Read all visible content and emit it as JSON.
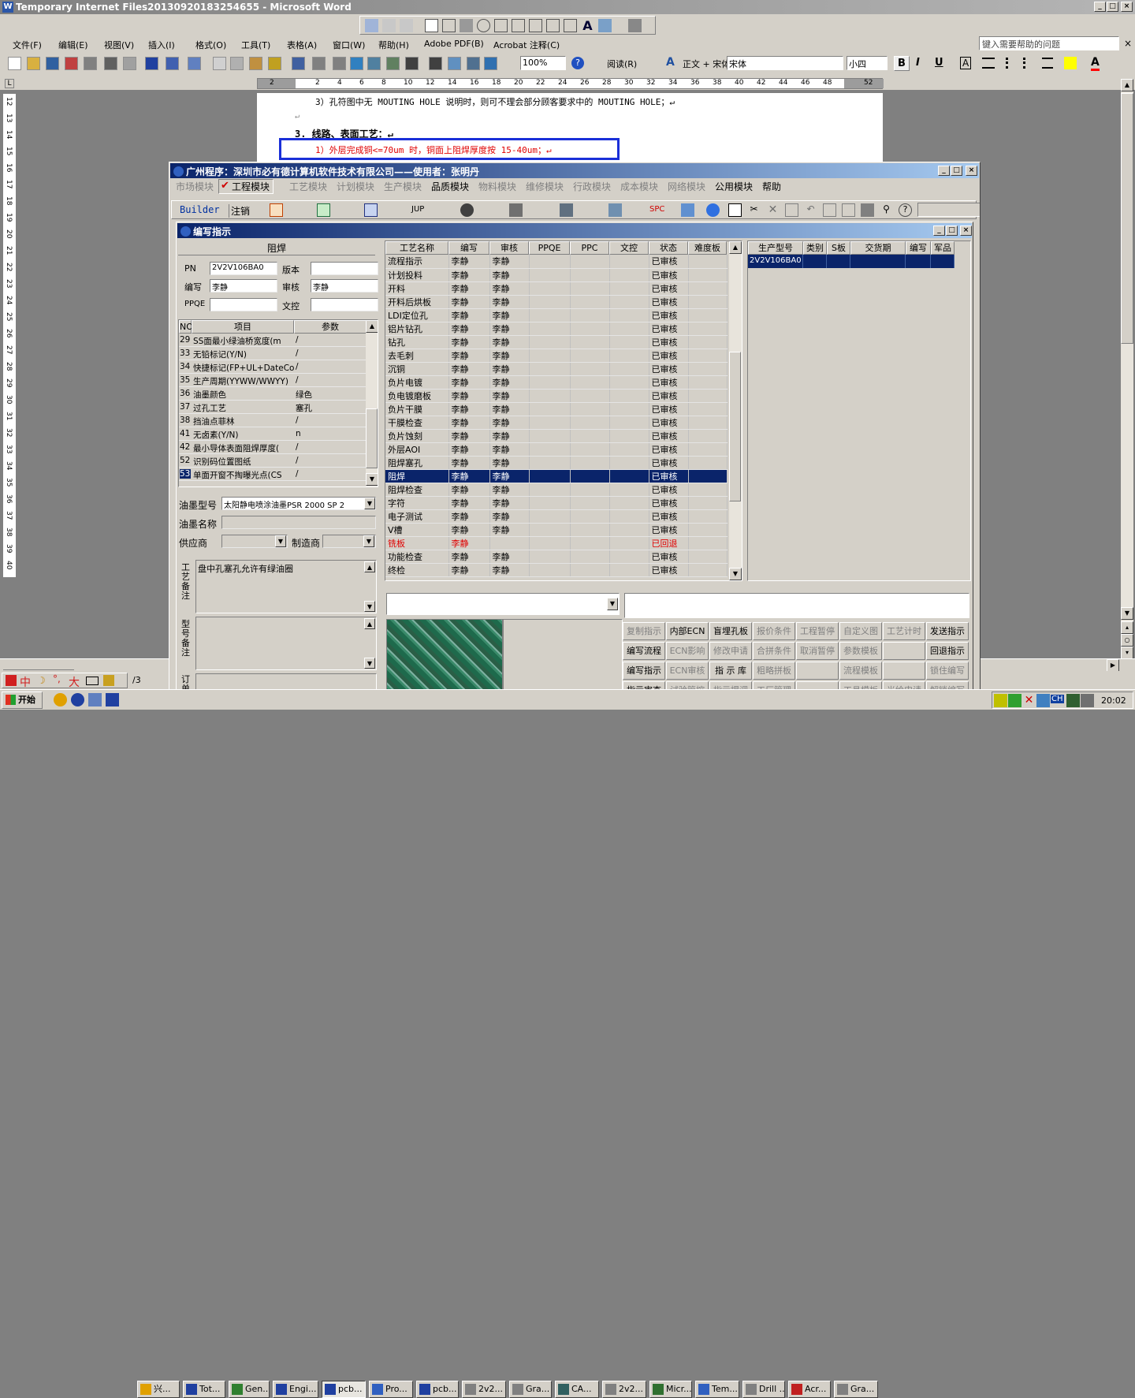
{
  "word": {
    "title": "Temporary Internet Files20130920183254655 - Microsoft Word",
    "menu": [
      "文件(F)",
      "编辑(E)",
      "视图(V)",
      "插入(I)",
      "格式(O)",
      "工具(T)",
      "表格(A)",
      "窗口(W)",
      "帮助(H)",
      "Adobe PDF(B)",
      "Acrobat 注释(C)"
    ],
    "help_placeholder": "键入需要帮助的问题",
    "zoom": "100%",
    "read_label": "阅读(R)",
    "style": "正文 + 宋体",
    "font": "宋体",
    "size": "小四",
    "ruler": [
      "2",
      "2",
      "4",
      "6",
      "8",
      "10",
      "12",
      "14",
      "16",
      "18",
      "20",
      "22",
      "24",
      "26",
      "28",
      "30",
      "32",
      "34",
      "36",
      "38",
      "40",
      "42",
      "44",
      "46",
      "48",
      "52"
    ],
    "vruler": [
      "12",
      "13",
      "14",
      "15",
      "16",
      "17",
      "18",
      "19",
      "20",
      "21",
      "22",
      "23",
      "24",
      "25",
      "26",
      "27",
      "28",
      "29",
      "30",
      "31",
      "32",
      "33",
      "34",
      "35",
      "36",
      "37",
      "38",
      "39",
      "40"
    ],
    "doc_line1": "3）孔符图中无 MOUTING HOLE 说明时，则可不理会部分顾客要求中的 MOUTING HOLE；↵",
    "doc_line2": "↵",
    "doc_heading": "3.    线路、表面工艺：↵",
    "doc_line3": "1）外层完成铜<=70um 时，铜面上阻焊厚度按 15-40um；↵",
    "status_page": "/3"
  },
  "app": {
    "title": "广州程序：深圳市必有德计算机软件技术有限公司——使用者：张明丹",
    "menu": [
      {
        "label": "市场模块",
        "en": false
      },
      {
        "label": "工程模块",
        "en": true
      },
      {
        "label": "工艺模块",
        "en": false
      },
      {
        "label": "计划模块",
        "en": false
      },
      {
        "label": "生产模块",
        "en": false
      },
      {
        "label": "品质模块",
        "en": true
      },
      {
        "label": "物料模块",
        "en": false
      },
      {
        "label": "维修模块",
        "en": false
      },
      {
        "label": "行政模块",
        "en": false
      },
      {
        "label": "成本模块",
        "en": false
      },
      {
        "label": "网络模块",
        "en": false
      },
      {
        "label": "公用模块",
        "en": true
      },
      {
        "label": "帮助",
        "en": true
      }
    ],
    "toolbar": {
      "builder": "Builder",
      "logout": "注销",
      "jup": "JUP",
      "spc": "SPC"
    }
  },
  "dialog": {
    "title": "编写指示",
    "section": "阻焊",
    "pn_label": "PN",
    "pn": "2V2V106BA0",
    "version_label": "版本",
    "version": "",
    "writer_label": "编写",
    "writer": "李静",
    "review_label": "审核",
    "reviewer": "李静",
    "ppqe_label": "PPQE",
    "ppqe": "",
    "control_label": "文控",
    "control": "",
    "params_headers": [
      "NO",
      "项目",
      "参数"
    ],
    "params": [
      {
        "no": "29",
        "item": "SS面最小绿油桥宽度(m",
        "val": "/"
      },
      {
        "no": "33",
        "item": "无铅标记(Y/N)",
        "val": "/"
      },
      {
        "no": "34",
        "item": "快捷标记(FP+UL+DateCo",
        "val": "/"
      },
      {
        "no": "35",
        "item": "生产周期(YYWW/WWYY)",
        "val": "/"
      },
      {
        "no": "36",
        "item": "油墨颜色",
        "val": "绿色"
      },
      {
        "no": "37",
        "item": "过孔工艺",
        "val": "塞孔"
      },
      {
        "no": "38",
        "item": "挡油点菲林",
        "val": "/"
      },
      {
        "no": "41",
        "item": "无卤素(Y/N)",
        "val": "n"
      },
      {
        "no": "42",
        "item": "最小导体表面阻焊厚度(",
        "val": "/"
      },
      {
        "no": "52",
        "item": "识别码位置图纸",
        "val": "/"
      },
      {
        "no": "53",
        "item": "单面开窗不掏曝光点(CS",
        "val": "/"
      }
    ],
    "ink_model_label": "油墨型号",
    "ink_model": "太阳静电喷涂油墨PSR 2000 SP 2",
    "ink_name_label": "油墨名称",
    "ink_name": "",
    "supplier_label": "供应商",
    "supplier": "",
    "maker_label": "制造商",
    "maker": "",
    "process_note_label": "工艺备注",
    "process_note": "盘中孔塞孔允许有绿油圈",
    "model_note_label": "型号备注",
    "model_note": "",
    "order_label": "订单",
    "proc_headers": [
      "工艺名称",
      "编写",
      "审核",
      "PPQE",
      "PPC",
      "文控",
      "状态",
      "难度板"
    ],
    "proc_rows": [
      [
        "流程指示",
        "李静",
        "李静",
        "",
        "",
        "",
        "已审核",
        ""
      ],
      [
        "计划投料",
        "李静",
        "李静",
        "",
        "",
        "",
        "已审核",
        ""
      ],
      [
        "开料",
        "李静",
        "李静",
        "",
        "",
        "",
        "已审核",
        ""
      ],
      [
        "开料后烘板",
        "李静",
        "李静",
        "",
        "",
        "",
        "已审核",
        ""
      ],
      [
        "LDI定位孔",
        "李静",
        "李静",
        "",
        "",
        "",
        "已审核",
        ""
      ],
      [
        "铝片钻孔",
        "李静",
        "李静",
        "",
        "",
        "",
        "已审核",
        ""
      ],
      [
        "钻孔",
        "李静",
        "李静",
        "",
        "",
        "",
        "已审核",
        ""
      ],
      [
        "去毛刺",
        "李静",
        "李静",
        "",
        "",
        "",
        "已审核",
        ""
      ],
      [
        "沉铜",
        "李静",
        "李静",
        "",
        "",
        "",
        "已审核",
        ""
      ],
      [
        "负片电镀",
        "李静",
        "李静",
        "",
        "",
        "",
        "已审核",
        ""
      ],
      [
        "负电镀磨板",
        "李静",
        "李静",
        "",
        "",
        "",
        "已审核",
        ""
      ],
      [
        "负片干膜",
        "李静",
        "李静",
        "",
        "",
        "",
        "已审核",
        ""
      ],
      [
        "干膜检查",
        "李静",
        "李静",
        "",
        "",
        "",
        "已审核",
        ""
      ],
      [
        "负片蚀刻",
        "李静",
        "李静",
        "",
        "",
        "",
        "已审核",
        ""
      ],
      [
        "外层AOI",
        "李静",
        "李静",
        "",
        "",
        "",
        "已审核",
        ""
      ],
      [
        "阻焊塞孔",
        "李静",
        "李静",
        "",
        "",
        "",
        "已审核",
        ""
      ],
      [
        "阻焊",
        "李静",
        "李静",
        "",
        "",
        "",
        "已审核",
        ""
      ],
      [
        "阻焊检查",
        "李静",
        "李静",
        "",
        "",
        "",
        "已审核",
        ""
      ],
      [
        "字符",
        "李静",
        "李静",
        "",
        "",
        "",
        "已审核",
        ""
      ],
      [
        "电子测试",
        "李静",
        "李静",
        "",
        "",
        "",
        "已审核",
        ""
      ],
      [
        "V槽",
        "李静",
        "李静",
        "",
        "",
        "",
        "已审核",
        ""
      ],
      [
        "铣板",
        "李静",
        "",
        "",
        "",
        "",
        "已回退",
        ""
      ],
      [
        "功能检查",
        "李静",
        "李静",
        "",
        "",
        "",
        "已审核",
        ""
      ],
      [
        "终检",
        "李静",
        "李静",
        "",
        "",
        "",
        "已审核",
        ""
      ]
    ],
    "sel_row": 16,
    "red_row": 21,
    "prod_headers": [
      "生产型号",
      "类别",
      "S板",
      "交货期",
      "编写",
      "军品"
    ],
    "prod_row": [
      "2V2V106BA0",
      "",
      "",
      "",
      "",
      ""
    ],
    "buttons": [
      [
        {
          "l": "复制指示",
          "e": false
        },
        {
          "l": "内部ECN",
          "e": true
        },
        {
          "l": "盲埋孔板",
          "e": true
        },
        {
          "l": "报价条件",
          "e": false
        },
        {
          "l": "工程暂停",
          "e": false
        },
        {
          "l": "自定义图",
          "e": false
        },
        {
          "l": "工艺计时",
          "e": false
        },
        {
          "l": "发送指示",
          "e": true
        }
      ],
      [
        {
          "l": "编写流程",
          "e": true
        },
        {
          "l": "ECN影响",
          "e": false
        },
        {
          "l": "修改申请",
          "e": false
        },
        {
          "l": "合拼条件",
          "e": false
        },
        {
          "l": "取消暂停",
          "e": false
        },
        {
          "l": "参数模板",
          "e": false
        },
        {
          "l": "",
          "e": false
        },
        {
          "l": "回退指示",
          "e": true
        }
      ],
      [
        {
          "l": "编写指示",
          "e": true
        },
        {
          "l": "ECN审核",
          "e": false
        },
        {
          "l": "指 示 库",
          "e": true
        },
        {
          "l": "粗略拼板",
          "e": false
        },
        {
          "l": "",
          "e": false
        },
        {
          "l": "流程模板",
          "e": false
        },
        {
          "l": "",
          "e": false
        },
        {
          "l": "锁住编写",
          "e": false
        }
      ],
      [
        {
          "l": "指示审查",
          "e": true
        },
        {
          "l": "试验管控",
          "e": false
        },
        {
          "l": "指示提调",
          "e": false
        },
        {
          "l": "工厂管理",
          "e": false
        },
        {
          "l": "",
          "e": false
        },
        {
          "l": "工具模板",
          "e": false
        },
        {
          "l": "光绘申请",
          "e": false
        },
        {
          "l": "解锁编写",
          "e": false
        }
      ]
    ]
  },
  "taskbar": {
    "start": "开始",
    "items": [
      "兴...",
      "Tot...",
      "Gen...",
      "Engi...",
      "pcb...",
      "Pro...",
      "pcb...",
      "2v2...",
      "Gra...",
      "CA...",
      "2v2...",
      "Micr...",
      "Tem...",
      "Drill ...",
      "Acr...",
      "Gra..."
    ],
    "clock": "20:02",
    "ime": "CH"
  },
  "ime_bar": [
    "中",
    "大"
  ]
}
